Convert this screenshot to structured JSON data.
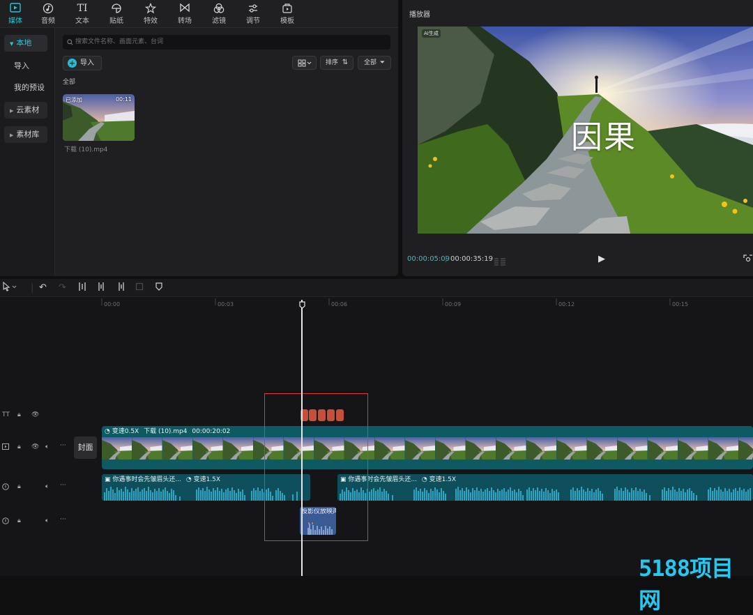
{
  "top_tabs": [
    {
      "label": "媒体",
      "icon": "media-icon"
    },
    {
      "label": "音频",
      "icon": "audio-icon"
    },
    {
      "label": "文本",
      "icon": "text-icon"
    },
    {
      "label": "贴纸",
      "icon": "sticker-icon"
    },
    {
      "label": "特效",
      "icon": "effects-icon"
    },
    {
      "label": "转场",
      "icon": "transition-icon"
    },
    {
      "label": "滤镜",
      "icon": "filter-icon"
    },
    {
      "label": "调节",
      "icon": "adjust-icon"
    },
    {
      "label": "模板",
      "icon": "template-icon"
    }
  ],
  "text_tab_glyph": "TI",
  "sidebar": {
    "items": [
      {
        "label": "本地"
      },
      {
        "label": "导入"
      },
      {
        "label": "我的预设"
      },
      {
        "label": "云素材"
      },
      {
        "label": "素材库"
      }
    ]
  },
  "media": {
    "search_placeholder": "搜索文件名称、画面元素、台词",
    "import_label": "导入",
    "sort_label": "排序",
    "filter_label": "全部",
    "section_label": "全部",
    "item": {
      "badge": "已添加",
      "duration": "00:11",
      "name": "下载 (10).mp4"
    }
  },
  "player": {
    "title": "播放器",
    "ai_badge": "AI生成",
    "caption": "因果",
    "current_time": "00:00:05:09",
    "total_time": "00:00:35:19"
  },
  "timeline": {
    "ruler_labels": [
      "00:00",
      "00:03",
      "00:06",
      "00:09",
      "00:12",
      "00:15"
    ],
    "cover_label": "封面",
    "text_track_glyph": "TT",
    "video_clip": {
      "speed": "变速0.5X",
      "name": "下载 (10).mp4",
      "duration": "00:00:20:02"
    },
    "audio_clips": [
      {
        "name": "你遇事时会先皱眉头还...",
        "speed": "变速1.5X"
      },
      {
        "name": "你遇事时会先皱眉头还...",
        "speed": "变速1.5X"
      }
    ],
    "sfx_clip": {
      "name": "投影仪放映声"
    }
  },
  "watermark": "5188项目网",
  "colors": {
    "accent": "#23c6d8",
    "highlight_box": "#e0392f",
    "video_track": "#0e5a63",
    "sfx_clip": "#3a5a94"
  }
}
